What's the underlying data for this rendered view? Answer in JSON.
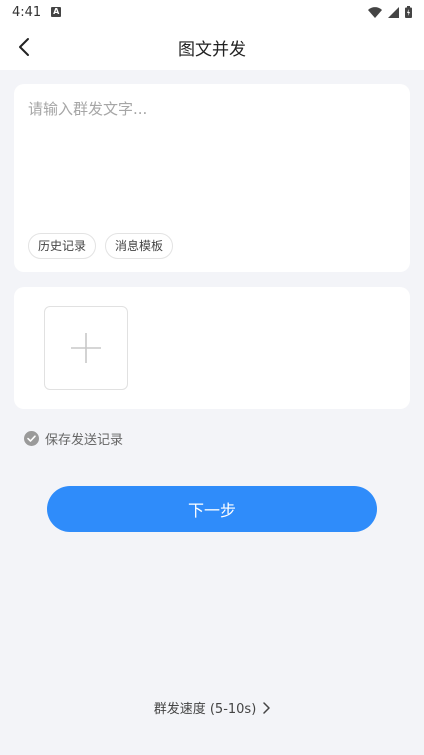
{
  "status_bar": {
    "time": "4:41",
    "notification_icon": "a-notification-icon",
    "wifi_icon": "wifi-icon",
    "signal_icon": "cell-signal-icon",
    "battery_icon": "battery-icon"
  },
  "nav": {
    "title": "图文并发",
    "back_icon": "chevron-left-icon"
  },
  "message": {
    "placeholder": "请输入群发文字...",
    "value": "",
    "chips": [
      "历史记录",
      "消息模板"
    ]
  },
  "image_upload": {
    "icon": "plus-icon"
  },
  "save_record": {
    "label": "保存发送记录",
    "checked": true,
    "icon": "check-circle-icon"
  },
  "next_button": {
    "label": "下一步",
    "color": "#2f8cfa"
  },
  "send_speed": {
    "label": "群发速度 (5-10s)",
    "icon": "chevron-right-icon"
  }
}
